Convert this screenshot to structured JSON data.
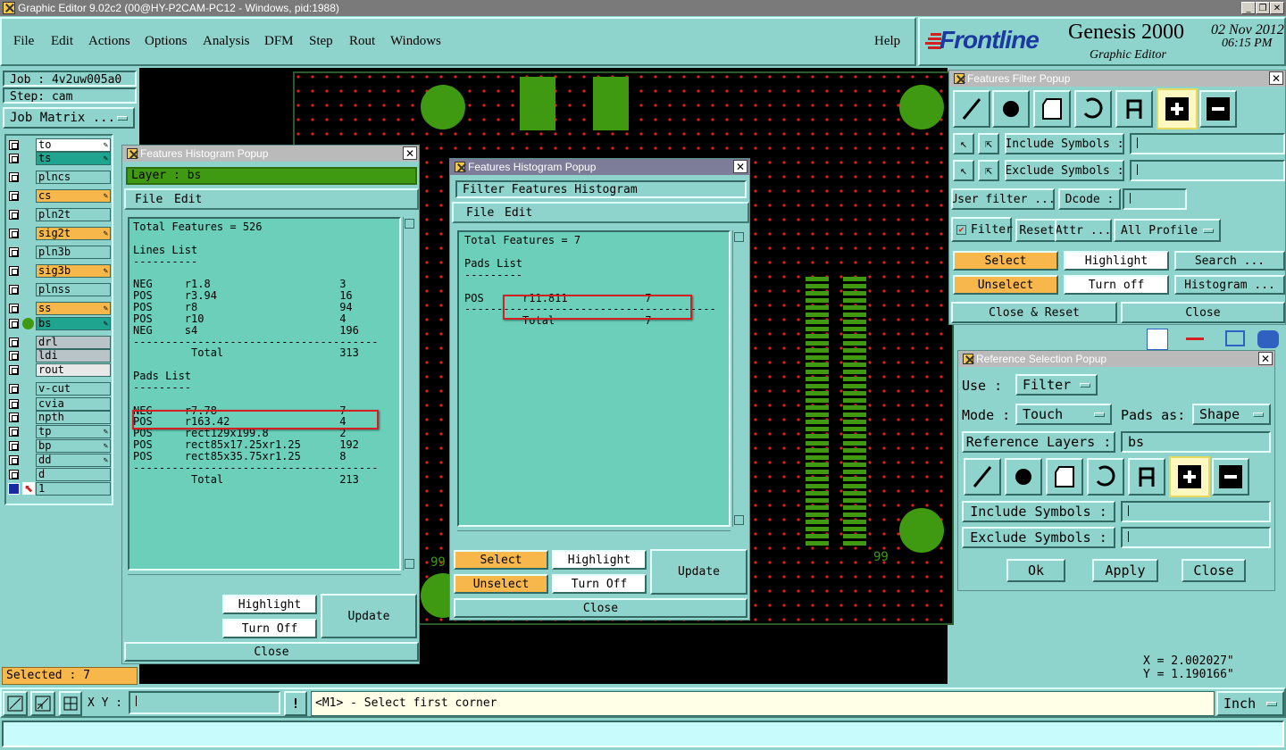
{
  "window": {
    "title": "Graphic Editor 9.02c2 (00@HY-P2CAM-PC12 - Windows, pid:1988)"
  },
  "menu": {
    "items": [
      "File",
      "Edit",
      "Actions",
      "Options",
      "Analysis",
      "DFM",
      "Step",
      "Rout",
      "Windows"
    ],
    "help": "Help"
  },
  "brand": {
    "logo": "Frontline",
    "product": "Genesis 2000",
    "date": "02 Nov 2012",
    "time": "06:15 PM",
    "subtitle": "Graphic Editor"
  },
  "job": {
    "job_label": "Job : 4v2uw005a0",
    "step_label": "Step: cam",
    "matrix_button": "Job Matrix ..."
  },
  "layers": [
    {
      "name": "to",
      "color": "#ffffff",
      "pen": true
    },
    {
      "name": "ts",
      "color": "#1fa48f",
      "pen": true
    },
    {
      "name": "plncs",
      "color": "#8fd4cc",
      "pen": false
    },
    {
      "name": "cs",
      "color": "#f7b74a",
      "pen": true
    },
    {
      "name": "pln2t",
      "color": "#8fd4cc",
      "pen": false
    },
    {
      "name": "sig2t",
      "color": "#f7b74a",
      "pen": true
    },
    {
      "name": "pln3b",
      "color": "#8fd4cc",
      "pen": false
    },
    {
      "name": "sig3b",
      "color": "#f7b74a",
      "pen": true
    },
    {
      "name": "plnss",
      "color": "#8fd4cc",
      "pen": false
    },
    {
      "name": "ss",
      "color": "#f7b74a",
      "pen": true
    },
    {
      "name": "bs",
      "color": "#1fa48f",
      "pen": true
    },
    {
      "name": "drl",
      "color": "#b8c4c8",
      "pen": false
    },
    {
      "name": "ldi",
      "color": "#b8c4c8",
      "pen": false
    },
    {
      "name": "rout",
      "color": "#e8e8e8",
      "pen": false
    },
    {
      "name": "v-cut",
      "color": "#8fd4cc",
      "pen": false
    },
    {
      "name": "cvia",
      "color": "#8fd4cc",
      "pen": false
    },
    {
      "name": "npth",
      "color": "#8fd4cc",
      "pen": false
    },
    {
      "name": "tp",
      "color": "#8fd4cc",
      "pen": true
    },
    {
      "name": "bp",
      "color": "#8fd4cc",
      "pen": true
    },
    {
      "name": "dd",
      "color": "#8fd4cc",
      "pen": true
    },
    {
      "name": "d",
      "color": "#8fd4cc",
      "pen": false
    },
    {
      "name": "1",
      "color": "#8fd4cc",
      "pen": false
    }
  ],
  "status": {
    "selected": "Selected : 7",
    "xy_label": "X Y :",
    "xy_value": "",
    "message": "<M1> - Select first corner",
    "units": "Inch",
    "x_coord": "X = 2.002027\"",
    "y_coord": "Y = 1.190166\""
  },
  "hist1": {
    "title": "Features Histogram Popup",
    "layer": "Layer :  bs",
    "menu": [
      "File",
      "Edit"
    ],
    "lines": [
      "Total Features = 526",
      "",
      "Lines List",
      "----------",
      "",
      "NEG     r1.8                    3",
      "POS     r3.94                   16",
      "POS     r8                      94",
      "POS     r10                     4",
      "NEG     s4                      196",
      "--------------------------------------",
      "         Total                  313",
      "",
      "Pads List",
      "---------",
      "",
      "NEG     r7.78                   7",
      "POS     r163.42                 4",
      "POS     rect129x199.8           2",
      "POS     rect85x17.25xr1.25      192",
      "POS     rect85x35.75xr1.25      8",
      "--------------------------------------",
      "         Total                  213"
    ],
    "highlight": "Highlight",
    "turn_off": "Turn Off",
    "update": "Update",
    "close": "Close"
  },
  "hist2": {
    "title": "Features Histogram Popup",
    "header": "Filter Features Histogram",
    "menu": [
      "File",
      "Edit"
    ],
    "lines": [
      "Total Features = 7",
      "",
      "Pads List",
      "---------",
      "",
      "POS      r11.811            7",
      "---------------------------------------",
      "         Total              7"
    ],
    "select": "Select",
    "highlight": "Highlight",
    "unselect": "Unselect",
    "turn_off": "Turn Off",
    "update": "Update",
    "close": "Close"
  },
  "filter": {
    "title": "Features Filter Popup",
    "include": "Include Symbols :",
    "exclude": "Exclude Symbols :",
    "user_filter": "User filter ...",
    "dcode": "Dcode :",
    "filter": "Filter",
    "reset": "Reset",
    "attr": "Attr ...",
    "profile": "All Profile",
    "select": "Select",
    "highlight": "Highlight",
    "search": "Search ...",
    "unselect": "Unselect",
    "turn_off": "Turn off",
    "histogram": "Histogram ...",
    "close_reset": "Close & Reset",
    "close": "Close"
  },
  "refsel": {
    "title": "Reference Selection Popup",
    "use_label": "Use   :",
    "use_value": "Filter",
    "mode_label": "Mode :",
    "mode_value": "Touch",
    "pads_label": "Pads as:",
    "pads_value": "Shape",
    "ref_layers": "Reference Layers :",
    "ref_value": "bs",
    "include": "Include Symbols :",
    "exclude": "Exclude Symbols :",
    "ok": "Ok",
    "apply": "Apply",
    "close": "Close"
  },
  "colors": {
    "panel": "#8fd4cc",
    "orange": "#f7b74a",
    "green": "#3f9a12",
    "pad_red": "#e02020",
    "highlight_red": "#d42020"
  }
}
